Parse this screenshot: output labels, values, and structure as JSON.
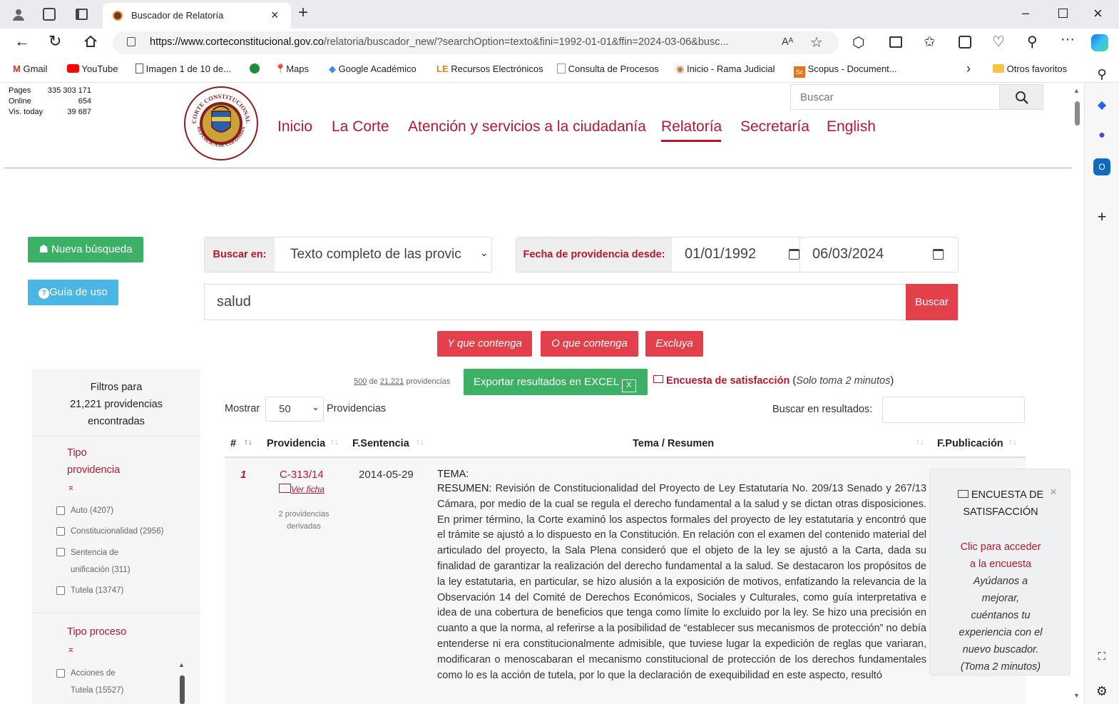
{
  "browser": {
    "tab_title": "Buscador de Relatoría",
    "url_host": "https://www.corteconstitucional.gov.co",
    "url_rest": "/relatoria/buscador_new/?searchOption=texto&fini=1992-01-01&ffin=2024-03-06&busc...",
    "bookmarks": [
      "Gmail",
      "YouTube",
      "Imagen 1 de 10 de...",
      "Maps",
      "Google Académico",
      "Recursos Electrónicos",
      "Consulta de Procesos",
      "Inicio - Rama Judicial",
      "Scopus - Document..."
    ],
    "other_favorites": "Otros favoritos",
    "reading_icon_text": "Aᴬ"
  },
  "stats": {
    "labels": [
      "Pages",
      "Online",
      "Vis. today"
    ],
    "values": [
      "335 303 171",
      "654",
      "39 687"
    ]
  },
  "header": {
    "seal_text_top": "CORTE CONSTITUCIONAL",
    "seal_text_bottom": "REPÚBLICA DE COLOMBIA",
    "search_placeholder": "Buscar",
    "nav": [
      "Inicio",
      "La Corte",
      "Atención y servicios a la ciudadanía",
      "Relatoría",
      "Secretaría",
      "English"
    ]
  },
  "search": {
    "new_search": "Nueva búsqueda",
    "guide": "Guía de uso",
    "search_in_label": "Buscar en:",
    "search_in_value": "Texto completo de las provic",
    "date_label": "Fecha de providencia desde:",
    "date_from": "01/01/1992",
    "date_to": "06/03/2024",
    "query": "salud",
    "search_button": "Buscar",
    "and_button": "Y que contenga",
    "or_button": "O que contenga",
    "exclude_button": "Excluya"
  },
  "results": {
    "count_shown": "500",
    "count_of": "de",
    "count_total": "21.221",
    "count_suffix": "providencias",
    "export_button": "Exportar resultados en EXCEL",
    "survey_link": "Encuesta de satisfacción",
    "survey_note": "Solo toma 2 minutos",
    "show_label": "Mostrar",
    "show_value": "50",
    "show_suffix": "Providencias",
    "filter_label": "Buscar en resultados:"
  },
  "filters": {
    "title_line1": "Filtros para",
    "title_line2": "21,221 providencias",
    "title_line3": "encontradas",
    "group1_line1": "Tipo",
    "group1_line2": "providencia",
    "group1_items": [
      "Auto (4207)",
      "Constitucionalidad (2956)",
      "Sentencia de",
      "unificación (311)",
      "Tutela (13747)"
    ],
    "group2": "Tipo proceso",
    "group2_items": [
      "Acciones de",
      "Tutela (15527)"
    ]
  },
  "table": {
    "headers": [
      "#",
      "Providencia",
      "F.Sentencia",
      "Tema / Resumen",
      "F.Publicación"
    ],
    "rows": [
      {
        "num": "1",
        "providencia": "C-313/14",
        "ver_ficha": "Ver ficha",
        "derived_line1": "2 providencias",
        "derived_line2": "derivadas",
        "fecha": "2014-05-29",
        "tema_label": "TEMA:",
        "resumen_label": "RESUMEN:",
        "resumen": "Revisión de Constitucionalidad del Proyecto de Ley Estatutaria No. 209/13 Senado y 267/13 Cámara, por medio de la cual se regula el derecho fundamental a la salud y se dictan otras disposiciones. En primer término, la Corte examinó los aspectos formales del proyecto de ley estatutaria y encontró que el trámite se ajustó a lo dispuesto en la Constitución. En relación con el examen del contenido material del articulado del proyecto, la Sala Plena consideró que el objeto de la ley se ajustó a la Carta, dada su finalidad de garantizar la realización del derecho fundamental a la salud. Se destacaron los propósitos de la ley estatutaria, en particular, se hizo alusión a la exposición de motivos, enfatizando la relevancia de la Observación 14 del Comité de Derechos Económicos, Sociales y Culturales, como guía interpretativa e idea de una cobertura de beneficios que tenga como límite lo excluido por la ley. Se hizo una precisión en cuanto a que la norma, al referirse a la posibilidad de “establecer sus mecanismos de protección” no debía entenderse ni era constitucionalmente admisible, que tuviese lugar la expedición de reglas que variaran, modificaran o menoscabaran el mecanismo constitucional de protección de los derechos fundamentales como lo es la acción de tutela, por lo que la declaración de exequibilidad en este aspecto, resultó"
      }
    ]
  },
  "survey_popup": {
    "title_line1": "ENCUESTA DE",
    "title_line2": "SATISFACCIÓN",
    "link_line1": "Clic para acceder",
    "link_line2": "a la encuesta",
    "body": [
      "Ayúdanos a",
      "mejorar,",
      "cuéntanos tu",
      "experiencia con el",
      "nuevo buscador.",
      "(Toma 2 minutos)"
    ]
  }
}
